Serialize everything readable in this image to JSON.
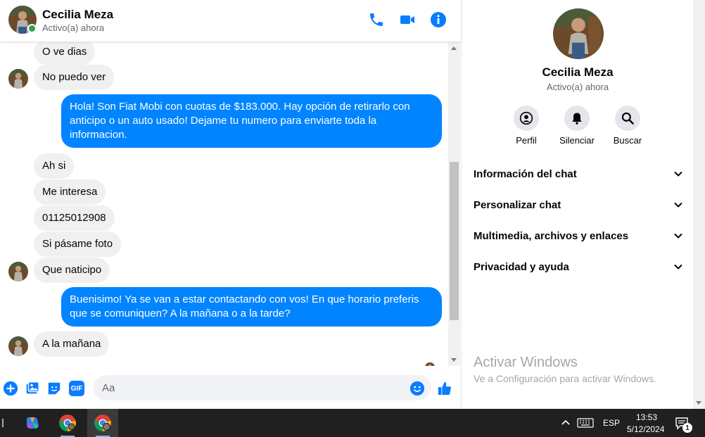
{
  "contact": {
    "name": "Cecilia Meza",
    "status": "Activo(a) ahora"
  },
  "header_icons": [
    "phone-icon",
    "video-camera-icon",
    "info-icon"
  ],
  "messages": [
    {
      "dir": "in",
      "text": "O ve dias"
    },
    {
      "dir": "in",
      "text": "No puedo ver"
    },
    {
      "dir": "out",
      "text": "Hola! Son Fiat Mobi con cuotas de $183.000. Hay opción de retirarlo con anticipo o un auto usado! Dejame tu numero para enviarte toda la informacion."
    },
    {
      "dir": "in",
      "text": "Ah si"
    },
    {
      "dir": "in",
      "text": "Me interesa"
    },
    {
      "dir": "in",
      "text": "01125012908"
    },
    {
      "dir": "in",
      "text": "Si pásame foto"
    },
    {
      "dir": "in",
      "text": "Que naticipo"
    },
    {
      "dir": "out",
      "text": "Buenisimo! Ya se van a estar contactando con vos! En que horario preferis que se comuniquen? A la mañana o a la tarde?"
    },
    {
      "dir": "in",
      "text": "A la mañana"
    }
  ],
  "composer": {
    "placeholder": "Aa",
    "icons": [
      "plus-icon",
      "image-icon",
      "sticker-icon",
      "gif-icon",
      "emoji-icon",
      "thumbs-up-icon"
    ],
    "gif_label": "GIF"
  },
  "info_panel": {
    "actions": [
      {
        "label": "Perfil",
        "icon": "profile-icon"
      },
      {
        "label": "Silenciar",
        "icon": "bell-icon"
      },
      {
        "label": "Buscar",
        "icon": "search-icon"
      }
    ],
    "sections": [
      "Información del chat",
      "Personalizar chat",
      "Multimedia, archivos y enlaces",
      "Privacidad y ayuda"
    ]
  },
  "watermark": {
    "title": "Activar Windows",
    "subtitle": "Ve a Configuración para activar Windows."
  },
  "taskbar": {
    "language": "ESP",
    "time": "13:53",
    "date": "5/12/2024",
    "notification_count": "1"
  },
  "colors": {
    "accent": "#0084ff",
    "icon_blue": "#0a7cff",
    "incoming_bubble": "#f0f0f0",
    "online": "#31a24c"
  }
}
